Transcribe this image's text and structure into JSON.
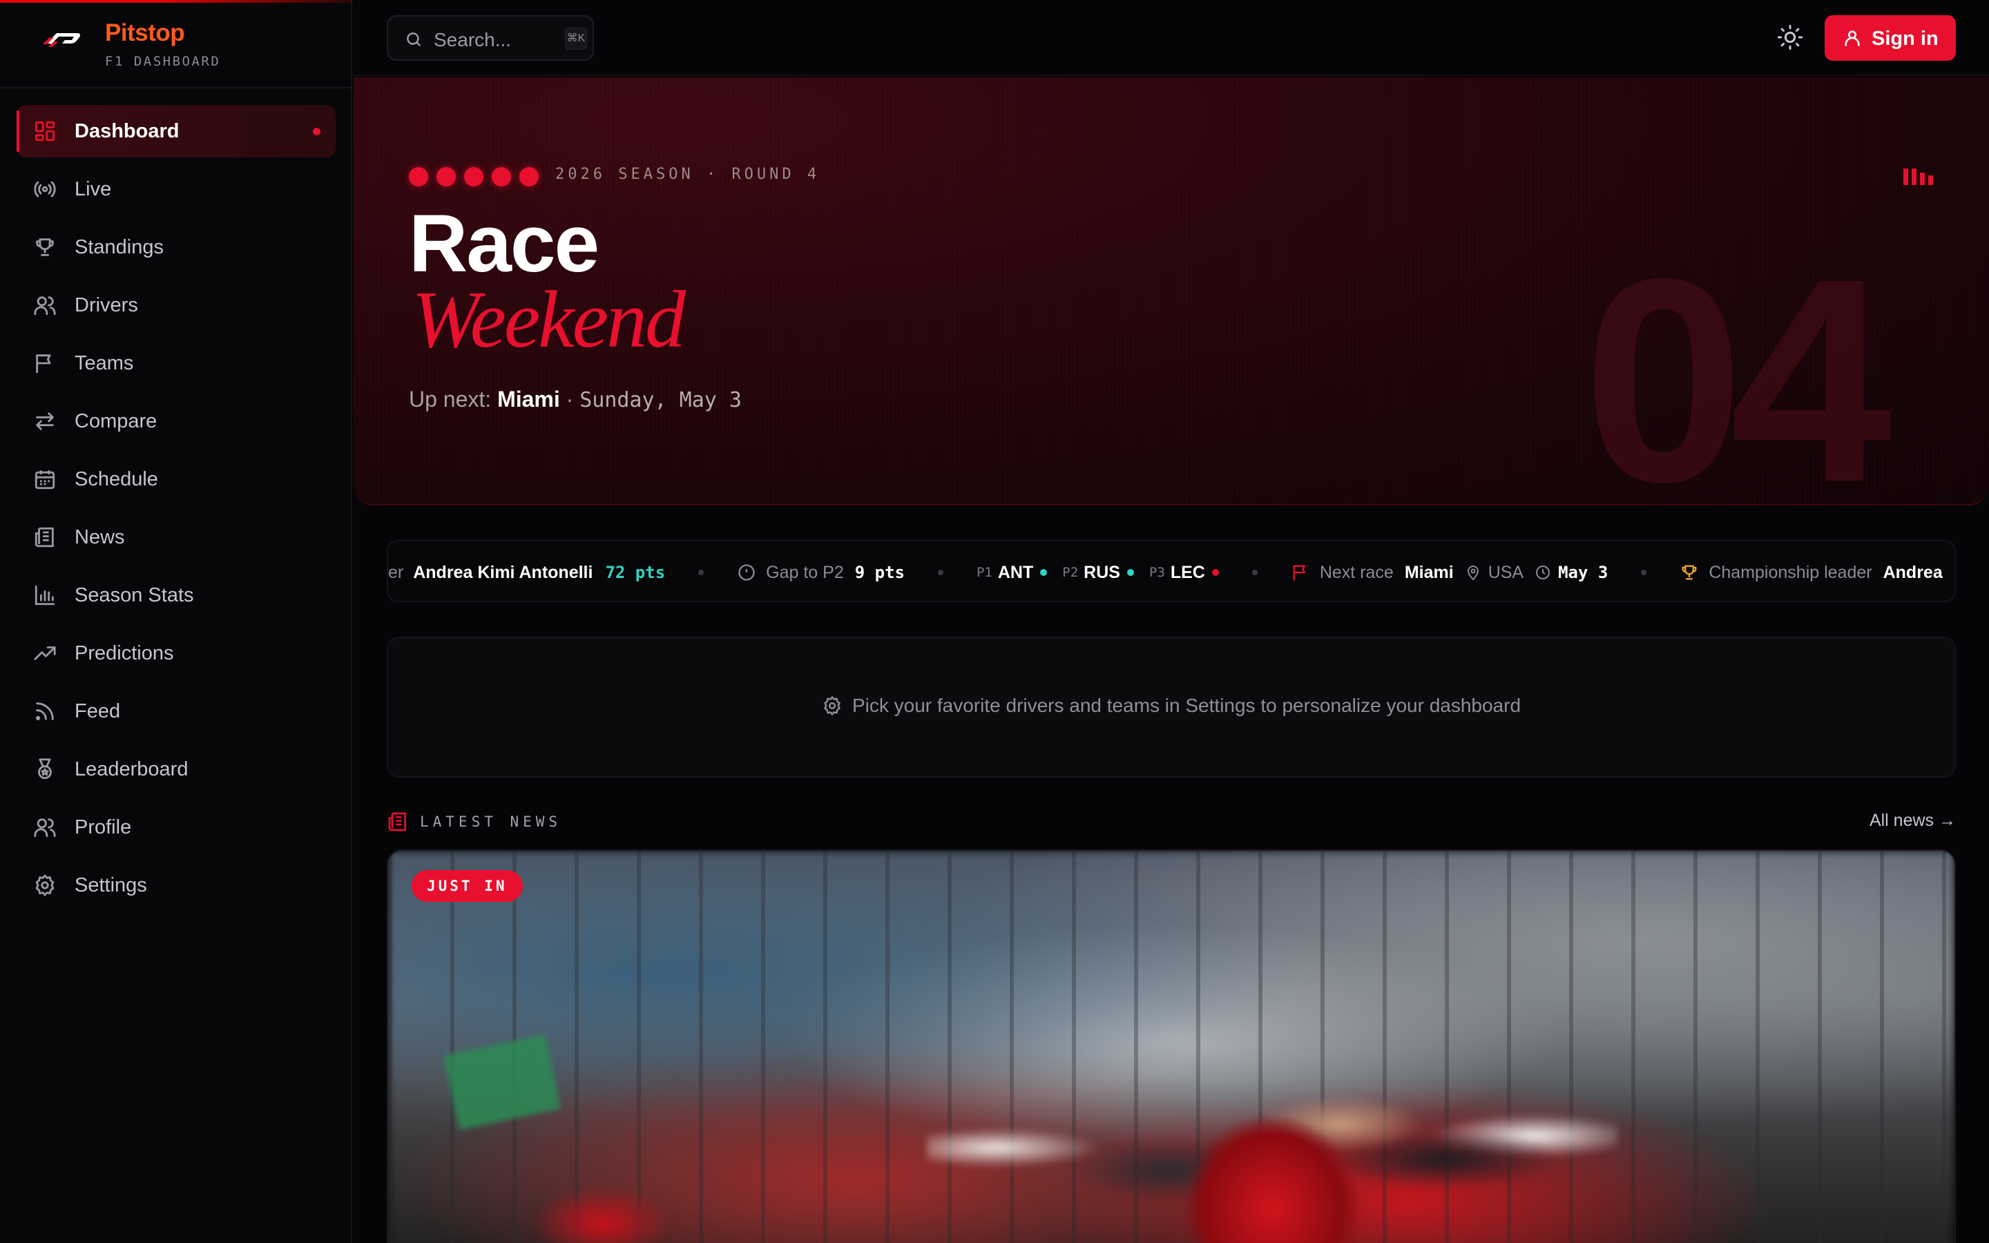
{
  "brand": {
    "name": "Pitstop",
    "subtitle": "F1 DASHBOARD"
  },
  "sidebar": {
    "items": [
      {
        "label": "Dashboard",
        "icon": "grid-icon",
        "active": true
      },
      {
        "label": "Live",
        "icon": "broadcast-icon"
      },
      {
        "label": "Standings",
        "icon": "trophy-icon"
      },
      {
        "label": "Drivers",
        "icon": "users-icon"
      },
      {
        "label": "Teams",
        "icon": "flag-icon"
      },
      {
        "label": "Compare",
        "icon": "arrows-swap-icon"
      },
      {
        "label": "Schedule",
        "icon": "calendar-icon"
      },
      {
        "label": "News",
        "icon": "newspaper-icon"
      },
      {
        "label": "Season Stats",
        "icon": "bar-chart-icon"
      },
      {
        "label": "Predictions",
        "icon": "trending-up-icon"
      },
      {
        "label": "Feed",
        "icon": "rss-icon"
      },
      {
        "label": "Leaderboard",
        "icon": "medal-icon"
      },
      {
        "label": "Profile",
        "icon": "user-icon"
      },
      {
        "label": "Settings",
        "icon": "gear-icon"
      }
    ]
  },
  "topbar": {
    "search_placeholder": "Search...",
    "search_shortcut": "⌘K",
    "signin_label": "Sign in"
  },
  "hero": {
    "meta": "2026 SEASON · ROUND 4",
    "title": "Race",
    "title_accent": "Weekend",
    "upnext_prefix": "Up next:",
    "upnext_city": "Miami",
    "upnext_sep": "·",
    "upnext_date": "Sunday, May 3",
    "round_number": "04"
  },
  "ticker": {
    "leader_prefix": "er",
    "leader_name": "Andrea Kimi Antonelli",
    "leader_points": "72 pts",
    "gap_label": "Gap to P2",
    "gap_value": "9 pts",
    "podium": [
      {
        "pos": "P1",
        "code": "ANT",
        "color": "#2dd4bf"
      },
      {
        "pos": "P2",
        "code": "RUS",
        "color": "#2dd4bf"
      },
      {
        "pos": "P3",
        "code": "LEC",
        "color": "#e8102e"
      }
    ],
    "next_race_label": "Next race",
    "next_race_city": "Miami",
    "next_race_country": "USA",
    "next_race_date": "May 3",
    "champ_label": "Championship leader",
    "champ_name": "Andrea"
  },
  "personalize": {
    "text": "Pick your favorite drivers and teams in Settings to personalize your dashboard"
  },
  "news": {
    "section_label": "LATEST NEWS",
    "all_link": "All news",
    "badge": "JUST IN"
  },
  "colors": {
    "accent": "#e8102e",
    "brand": "#ff5a1f",
    "teal": "#2dd4bf",
    "gold": "#f5a524"
  }
}
